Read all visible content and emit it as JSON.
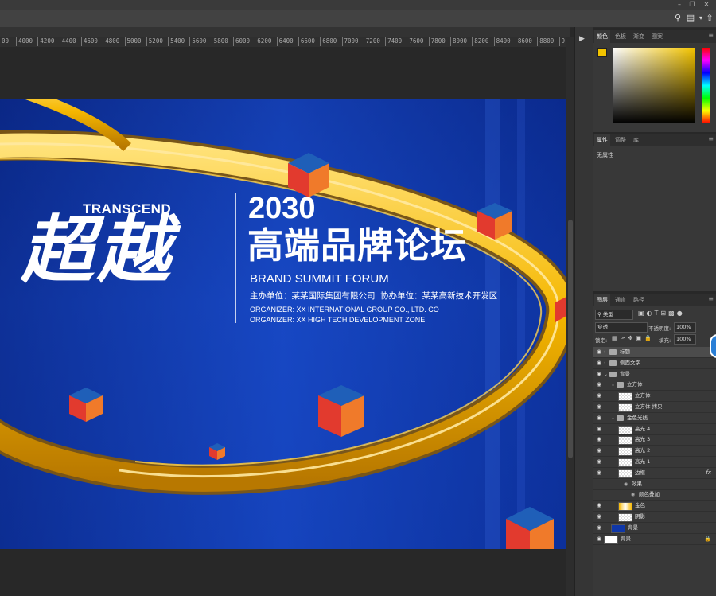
{
  "window": {
    "minimize_glyph": "–",
    "restore_glyph": "❐",
    "close_glyph": "✕"
  },
  "options_bar": {
    "search_icon": "search-icon",
    "workspace_icon": "workspace-icon",
    "share_icon": "share-icon"
  },
  "ruler": {
    "ticks": [
      "4000",
      "4200",
      "4400",
      "4600",
      "4800",
      "5000",
      "5200",
      "5400",
      "5600",
      "5800",
      "6000",
      "6200",
      "6400",
      "6600",
      "6800",
      "7000",
      "7200",
      "7400",
      "7600",
      "7800",
      "8000",
      "8200",
      "8400",
      "8600",
      "8800",
      "9"
    ],
    "left_partial": "00"
  },
  "artwork": {
    "brand_en": "TRANSCEND",
    "calligraphy": "超越",
    "year": "2030",
    "title_cn": "高端品牌论坛",
    "title_en": "BRAND SUMMIT FORUM",
    "organizers_cn": "主办单位：某某国际集团有限公司  协办单位：某某高新技术开发区",
    "organizer_1": "ORGANIZER: XX INTERNATIONAL GROUP CO., LTD. CO",
    "organizer_2": "ORGANIZER: XX HIGH TECH DEVELOPMENT ZONE",
    "colors": {
      "background": "#133fb5",
      "gold": "#f5b700",
      "cube_top": "#1f5fb8",
      "cube_left": "#e23a2e",
      "cube_right": "#f07a2a"
    }
  },
  "color_panel": {
    "tabs": [
      "颜色",
      "色板",
      "渐变",
      "图案"
    ],
    "foreground": "#f3c400",
    "background": "#ffffff"
  },
  "properties_panel": {
    "tabs": [
      "属性",
      "调整",
      "库"
    ],
    "empty_text": "无属性"
  },
  "layers_panel": {
    "tabs": [
      "图层",
      "通道",
      "路径"
    ],
    "filter_kind": "类型",
    "blend_mode": "穿透",
    "opacity_label": "不透明度:",
    "opacity_value": "100%",
    "lock_label": "锁定:",
    "fill_label": "填充:",
    "fill_value": "100%",
    "layers": [
      {
        "name": "标题",
        "type": "group",
        "level": 0,
        "expanded": false,
        "selected": true
      },
      {
        "name": "侧面文字",
        "type": "group",
        "level": 0,
        "expanded": false
      },
      {
        "name": "背景",
        "type": "group",
        "level": 0,
        "expanded": true
      },
      {
        "name": "立方体",
        "type": "group",
        "level": 1,
        "expanded": true
      },
      {
        "name": "立方体",
        "type": "layer",
        "level": 2
      },
      {
        "name": "立方体 拷贝",
        "type": "layer",
        "level": 2
      },
      {
        "name": "金色光线",
        "type": "group",
        "level": 1,
        "expanded": true
      },
      {
        "name": "高光 4",
        "type": "layer",
        "level": 2
      },
      {
        "name": "高光 3",
        "type": "layer",
        "level": 2
      },
      {
        "name": "高光 2",
        "type": "layer",
        "level": 2
      },
      {
        "name": "高光 1",
        "type": "layer",
        "level": 2
      },
      {
        "name": "边框",
        "type": "layer",
        "level": 2,
        "fx": "fx"
      },
      {
        "name": "效果",
        "type": "effect",
        "level": 3
      },
      {
        "name": "颜色叠加",
        "type": "effect",
        "level": 4
      },
      {
        "name": "金色",
        "type": "layer",
        "level": 2
      },
      {
        "name": "阴影",
        "type": "layer",
        "level": 2
      },
      {
        "name": "背景",
        "type": "fill",
        "level": 1
      },
      {
        "name": "背景",
        "type": "background",
        "level": 0,
        "locked": true
      }
    ]
  }
}
